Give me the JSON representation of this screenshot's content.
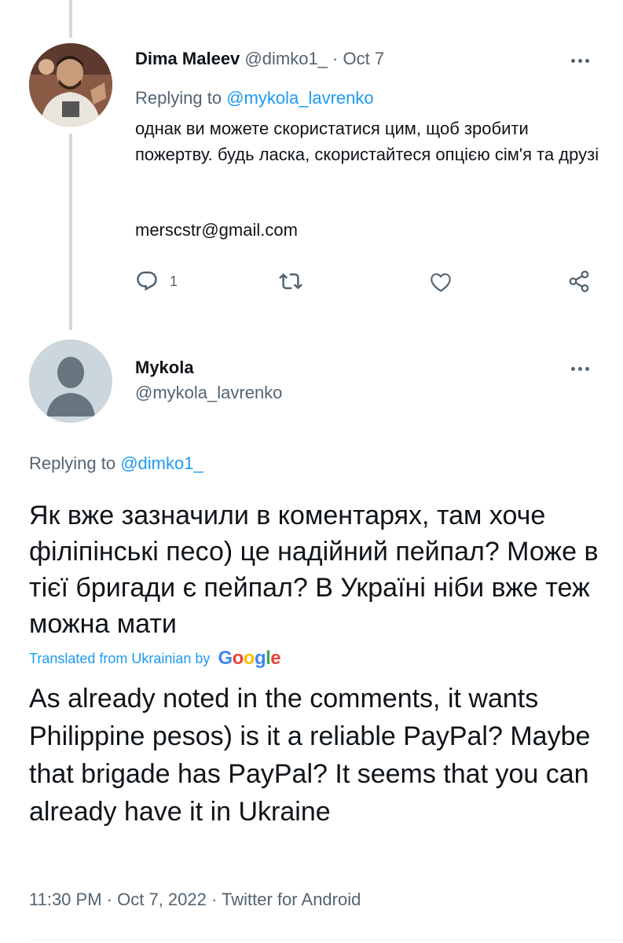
{
  "tweet1": {
    "author_name": "Dima Maleev",
    "author_handle": "@dimko1_",
    "separator": "·",
    "date": "Oct 7",
    "replying_prefix": "Replying to",
    "replying_handle": "@mykola_lavrenko",
    "text": "однак ви можете скористатися цим, щоб зробити пожертву. будь ласка, скористайтеся опцією сім'я та друзі",
    "email": "merscstr@gmail.com",
    "reply_count": "1"
  },
  "tweet2": {
    "author_name": "Mykola",
    "author_handle": "@mykola_lavrenko",
    "replying_prefix": "Replying to",
    "replying_handle": "@dimko1_",
    "text": "Як вже зазначили в коментарях, там хоче філіпінські песо) це надійний пейпал? Може в тієї бригади є пейпал? В Україні ніби вже теж можна мати",
    "translated_label": "Translated from Ukrainian by",
    "google": [
      "G",
      "o",
      "o",
      "g",
      "l",
      "e"
    ],
    "translation": "As already noted in the comments, it wants Philippine pesos) is it a reliable PayPal? Maybe that brigade has PayPal? It seems that you can already have it in Ukraine",
    "time": "11:30 PM",
    "separator": "·",
    "full_date": "Oct 7, 2022",
    "source": "Twitter for Android"
  },
  "colors": {
    "link": "#1d9bf0",
    "secondary_text": "#536471",
    "thread_line": "#cfd9de",
    "default_avatar_bg": "#ccd6dd"
  },
  "icons": [
    "more-icon",
    "reply-icon",
    "retweet-icon",
    "like-icon",
    "share-icon",
    "default-avatar-icon"
  ]
}
